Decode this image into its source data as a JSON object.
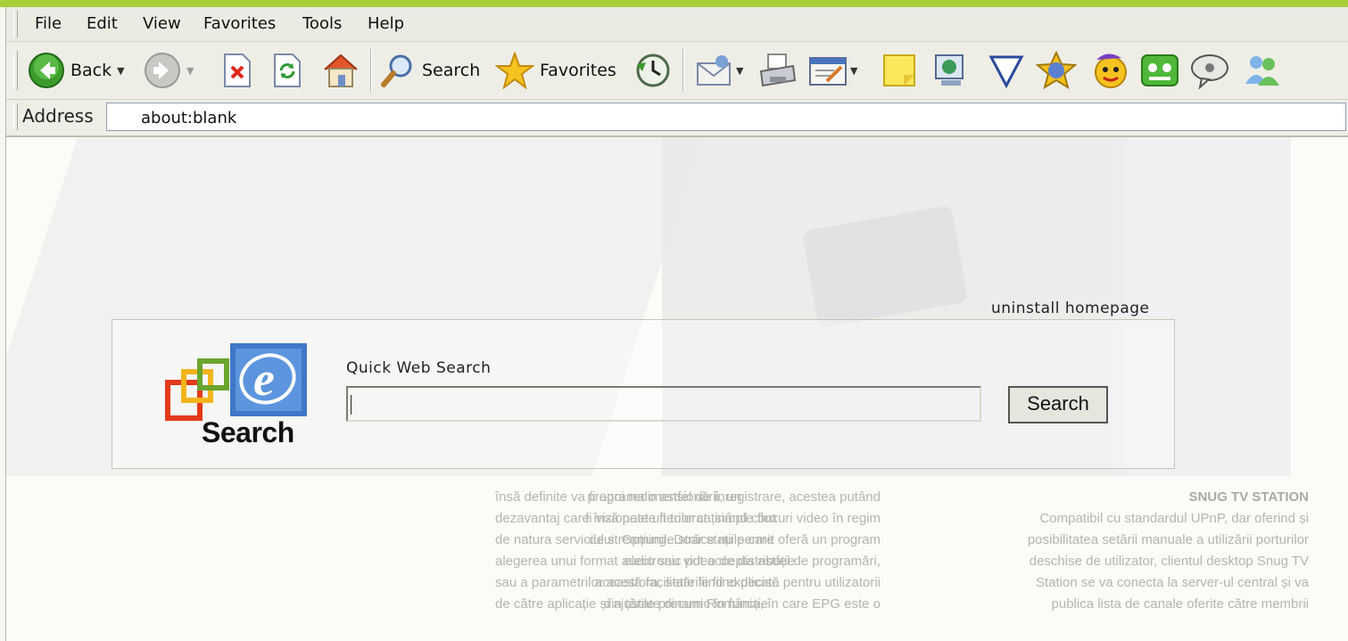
{
  "menu": {
    "items": [
      "File",
      "Edit",
      "View",
      "Favorites",
      "Tools",
      "Help"
    ]
  },
  "toolbar": {
    "back_label": "Back",
    "search_label": "Search",
    "favorites_label": "Favorites",
    "icons": [
      "back-icon",
      "forward-icon",
      "stop-icon",
      "refresh-icon",
      "home-icon",
      "search-icon",
      "favorites-icon",
      "history-icon",
      "mail-icon",
      "print-icon",
      "edit-icon",
      "notes-icon",
      "messenger-icon",
      "filter-icon",
      "smiley-icon",
      "emoticon-icon",
      "chat-icon",
      "discuss-icon",
      "contacts-icon"
    ]
  },
  "address": {
    "label": "Address",
    "value": "about:blank"
  },
  "page": {
    "uninstall_link": "uninstall homepage",
    "search_heading": "Quick Web Search",
    "search_button": "Search",
    "logo_text": "Search"
  },
  "background_columns": [
    {
      "heading": "",
      "lines": [
        "programa o astfel de înregistrare, acestea putând",
        "fi vizionate ulterior ca simple fluxuri video în regim",
        "de streaming. Doar stațiile care oferă un program",
        "electronic pot accepta astfel de programări,",
        "această facilitate fiind explicată pentru utilizatorii",
        "din țările precum România, în care EPG este o"
      ]
    },
    {
      "heading": "",
      "lines": [
        "însă definite va fi apoi redimensionării, un",
        "dezavantaj care însă poate fi tolerat ținând cont",
        "de natura serviciului. Opțiunile străce nu permit",
        "alegerea unui format audio sau video de distribuție",
        "sau a parametrilor acestora, setările fiind decise",
        "de către aplicație și ajustate dinamic în funcție"
      ]
    },
    {
      "heading": "SNUG TV STATION",
      "lines": [
        "Compatibil cu standardul UPnP, dar oferind și",
        "posibilitatea setării manuale a utilizării porturilor",
        "deschise de utilizator, clientul desktop Snug TV",
        "Station se va conecta la server-ul central și va",
        "publica lista de canale oferite către membrii"
      ]
    }
  ]
}
